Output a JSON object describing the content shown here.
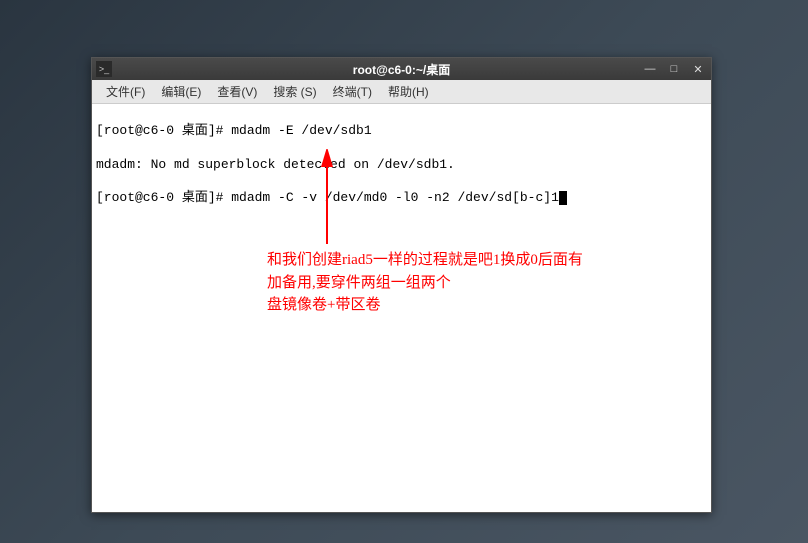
{
  "window": {
    "title": "root@c6-0:~/桌面",
    "icon_glyph": ">_"
  },
  "menubar": {
    "items": [
      {
        "label": "文件(F)",
        "key": "F"
      },
      {
        "label": "编辑(E)",
        "key": "E"
      },
      {
        "label": "查看(V)",
        "key": "V"
      },
      {
        "label": "搜索 (S)",
        "key": "S"
      },
      {
        "label": "终端(T)",
        "key": "T"
      },
      {
        "label": "帮助(H)",
        "key": "H"
      }
    ]
  },
  "terminal": {
    "lines": [
      "[root@c6-0 桌面]# mdadm -E /dev/sdb1",
      "mdadm: No md superblock detected on /dev/sdb1.",
      "[root@c6-0 桌面]# mdadm -C -v /dev/md0 -l0 -n2 /dev/sd[b-c]1"
    ]
  },
  "annotation": {
    "line1": "和我们创建riad5一样的过程就是吧1换成0后面有",
    "line2": "加备用,要穿件两组一组两个",
    "line3": "盘镜像卷+带区卷"
  },
  "controls": {
    "minimize": "—",
    "maximize": "□",
    "close": "✕"
  }
}
